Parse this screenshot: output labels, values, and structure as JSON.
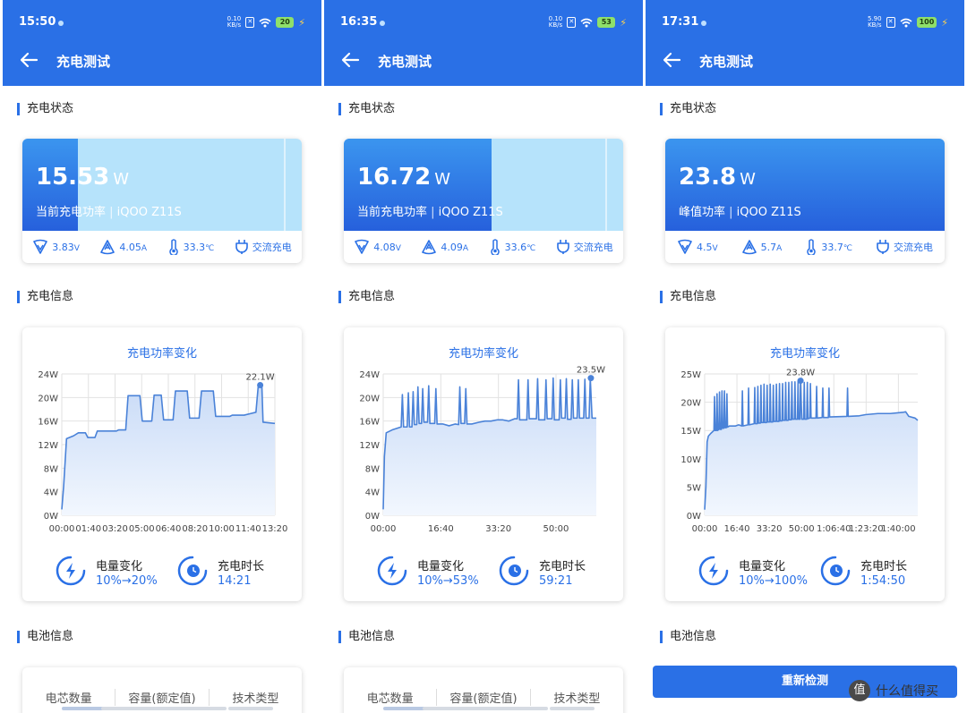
{
  "app_title": "充电测试",
  "sections": {
    "status": "充电状态",
    "info": "充电信息",
    "battery": "电池信息"
  },
  "chart_title": "充电功率变化",
  "labels": {
    "battery_change": "电量变化",
    "duration": "充电时长"
  },
  "battery_columns": [
    "电芯数量",
    "容量(额定值)",
    "技术类型"
  ],
  "recheck_button": "重新检测",
  "watermark": "什么值得买",
  "watermark_logo": "值",
  "colors": {
    "accent": "#2a70e6",
    "hero_light": "#b6e3fb",
    "status_bar": "#2a70e6"
  },
  "panels": [
    {
      "status_time": "15:50",
      "net_speed": "0.10",
      "net_unit": "KB/s",
      "battery_level": "20",
      "power_value": "15.53",
      "power_unit": "W",
      "power_label": "当前充电功率",
      "device": "iQOO Z11S",
      "hero_fill": 0.2,
      "voltage": "3.83",
      "voltage_unit": "V",
      "current": "4.05",
      "current_unit": "A",
      "temperature": "33.3",
      "temperature_unit": "℃",
      "charge_type": "交流充电",
      "battery_change": "10%→20%",
      "duration": "14:21",
      "chart_data": {
        "type": "line",
        "title": "充电功率变化",
        "y_ticks": [
          "0W",
          "4W",
          "8W",
          "12W",
          "16W",
          "20W",
          "24W"
        ],
        "ylim": [
          0,
          24
        ],
        "x_ticks": [
          "00:00",
          "01:40",
          "03:20",
          "05:00",
          "06:40",
          "08:20",
          "10:00",
          "11:40",
          "13:20"
        ],
        "xlim": [
          0,
          900
        ],
        "peak_label": "22.1W",
        "peak": [
          838,
          22.1
        ],
        "points": [
          [
            0,
            1
          ],
          [
            8,
            5
          ],
          [
            20,
            13
          ],
          [
            50,
            13.5
          ],
          [
            70,
            14
          ],
          [
            100,
            14
          ],
          [
            110,
            13.2
          ],
          [
            140,
            13.2
          ],
          [
            150,
            14.3
          ],
          [
            230,
            14.3
          ],
          [
            240,
            14.5
          ],
          [
            270,
            14.5
          ],
          [
            280,
            20.3
          ],
          [
            330,
            20.3
          ],
          [
            340,
            16
          ],
          [
            380,
            16
          ],
          [
            390,
            20.4
          ],
          [
            420,
            20.4
          ],
          [
            430,
            16.2
          ],
          [
            470,
            16.2
          ],
          [
            480,
            21.1
          ],
          [
            530,
            21.1
          ],
          [
            540,
            16.5
          ],
          [
            580,
            16.5
          ],
          [
            590,
            21.1
          ],
          [
            640,
            21.1
          ],
          [
            650,
            16.8
          ],
          [
            710,
            16.8
          ],
          [
            720,
            17
          ],
          [
            770,
            17
          ],
          [
            800,
            17.3
          ],
          [
            820,
            17.5
          ],
          [
            830,
            22.1
          ],
          [
            845,
            22.1
          ],
          [
            850,
            15.8
          ],
          [
            900,
            15.6
          ]
        ]
      }
    },
    {
      "status_time": "16:35",
      "net_speed": "0.10",
      "net_unit": "KB/s",
      "battery_level": "53",
      "power_value": "16.72",
      "power_unit": "W",
      "power_label": "当前充电功率",
      "device": "iQOO Z11S",
      "hero_fill": 0.53,
      "voltage": "4.08",
      "voltage_unit": "V",
      "current": "4.09",
      "current_unit": "A",
      "temperature": "33.6",
      "temperature_unit": "℃",
      "charge_type": "交流充电",
      "battery_change": "10%→53%",
      "duration": "59:21",
      "chart_data": {
        "type": "line",
        "title": "充电功率变化",
        "y_ticks": [
          "0W",
          "4W",
          "8W",
          "12W",
          "16W",
          "20W",
          "24W"
        ],
        "ylim": [
          0,
          24
        ],
        "x_ticks": [
          "00:00",
          "16:40",
          "33:20",
          "50:00"
        ],
        "xlim": [
          0,
          3561
        ],
        "peak_label": "23.5W",
        "peak": [
          3470,
          23.3
        ],
        "points": [
          [
            0,
            1
          ],
          [
            20,
            10
          ],
          [
            50,
            14
          ],
          [
            150,
            14.5
          ],
          [
            300,
            15
          ],
          [
            320,
            20.5
          ],
          [
            340,
            15
          ],
          [
            400,
            15
          ],
          [
            420,
            20.8
          ],
          [
            440,
            15
          ],
          [
            480,
            15
          ],
          [
            500,
            21
          ],
          [
            520,
            15.4
          ],
          [
            560,
            15.4
          ],
          [
            580,
            21.8
          ],
          [
            600,
            15.6
          ],
          [
            640,
            15.6
          ],
          [
            660,
            21.5
          ],
          [
            680,
            15.8
          ],
          [
            740,
            15.8
          ],
          [
            760,
            22
          ],
          [
            780,
            15.6
          ],
          [
            860,
            15.6
          ],
          [
            880,
            21.5
          ],
          [
            900,
            15.5
          ],
          [
            1000,
            15.5
          ],
          [
            1100,
            15.2
          ],
          [
            1200,
            15.5
          ],
          [
            1260,
            15.4
          ],
          [
            1280,
            21.8
          ],
          [
            1300,
            15.6
          ],
          [
            1360,
            15.6
          ],
          [
            1380,
            21.5
          ],
          [
            1400,
            15.5
          ],
          [
            1480,
            15.5
          ],
          [
            1600,
            15.8
          ],
          [
            1700,
            16
          ],
          [
            1800,
            16
          ],
          [
            1900,
            16.2
          ],
          [
            2000,
            16.2
          ],
          [
            2100,
            16
          ],
          [
            2200,
            16.4
          ],
          [
            2240,
            16.4
          ],
          [
            2260,
            23
          ],
          [
            2280,
            16.2
          ],
          [
            2400,
            16.2
          ],
          [
            2420,
            23
          ],
          [
            2440,
            16.4
          ],
          [
            2560,
            16.4
          ],
          [
            2580,
            23.2
          ],
          [
            2600,
            16.2
          ],
          [
            2700,
            16.2
          ],
          [
            2720,
            23
          ],
          [
            2740,
            16.4
          ],
          [
            2820,
            16.4
          ],
          [
            2840,
            23.3
          ],
          [
            2860,
            16.2
          ],
          [
            2940,
            16.2
          ],
          [
            2960,
            23
          ],
          [
            2980,
            16.5
          ],
          [
            3040,
            16.5
          ],
          [
            3060,
            23.2
          ],
          [
            3080,
            16.3
          ],
          [
            3140,
            16.3
          ],
          [
            3160,
            23
          ],
          [
            3180,
            16.5
          ],
          [
            3240,
            16.5
          ],
          [
            3260,
            23
          ],
          [
            3280,
            16.5
          ],
          [
            3350,
            16.5
          ],
          [
            3370,
            23.1
          ],
          [
            3390,
            16.5
          ],
          [
            3440,
            16.5
          ],
          [
            3460,
            23.3
          ],
          [
            3490,
            16.5
          ],
          [
            3561,
            16.5
          ]
        ]
      }
    },
    {
      "status_time": "17:31",
      "net_speed": "5.90",
      "net_unit": "KB/s",
      "battery_level": "100",
      "power_value": "23.8",
      "power_unit": "W",
      "power_label": "峰值功率",
      "device": "iQOO Z11S",
      "hero_fill": 1.0,
      "voltage": "4.5",
      "voltage_unit": "V",
      "current": "5.7",
      "current_unit": "A",
      "temperature": "33.7",
      "temperature_unit": "℃",
      "charge_type": "交流充电",
      "battery_change": "10%→100%",
      "duration": "1:54:50",
      "chart_data": {
        "type": "line",
        "title": "充电功率变化",
        "y_ticks": [
          "0W",
          "5W",
          "10W",
          "15W",
          "20W",
          "25W"
        ],
        "ylim": [
          0,
          25
        ],
        "x_ticks": [
          "00:00",
          "16:40",
          "33:20",
          "50:00",
          "1:06:40",
          "1:23:20",
          "1:40:00"
        ],
        "xlim": [
          0,
          6890
        ],
        "peak_label": "23.8W",
        "peak": [
          3100,
          23.8
        ],
        "points": [
          [
            0,
            1
          ],
          [
            40,
            5
          ],
          [
            80,
            13
          ],
          [
            120,
            14
          ],
          [
            200,
            14.5
          ],
          [
            300,
            15
          ],
          [
            320,
            21
          ],
          [
            340,
            15
          ],
          [
            380,
            15
          ],
          [
            400,
            21.5
          ],
          [
            420,
            15
          ],
          [
            460,
            15.2
          ],
          [
            480,
            21.8
          ],
          [
            500,
            15.2
          ],
          [
            540,
            15.2
          ],
          [
            560,
            22
          ],
          [
            580,
            15.4
          ],
          [
            620,
            15.4
          ],
          [
            640,
            22
          ],
          [
            660,
            15.5
          ],
          [
            700,
            15.5
          ],
          [
            720,
            21.5
          ],
          [
            740,
            15.6
          ],
          [
            800,
            15.8
          ],
          [
            900,
            15.8
          ],
          [
            1000,
            15.8
          ],
          [
            1100,
            16
          ],
          [
            1200,
            15.8
          ],
          [
            1220,
            22
          ],
          [
            1240,
            15.8
          ],
          [
            1400,
            16
          ],
          [
            1420,
            22.5
          ],
          [
            1440,
            16
          ],
          [
            1600,
            16.2
          ],
          [
            1620,
            22.6
          ],
          [
            1640,
            16.2
          ],
          [
            1700,
            16.2
          ],
          [
            1720,
            22.8
          ],
          [
            1740,
            16.3
          ],
          [
            1800,
            16.3
          ],
          [
            1820,
            23
          ],
          [
            1840,
            16.4
          ],
          [
            1900,
            16.4
          ],
          [
            1920,
            23.2
          ],
          [
            1940,
            16.4
          ],
          [
            2000,
            16.4
          ],
          [
            2020,
            23
          ],
          [
            2040,
            16.5
          ],
          [
            2100,
            16.5
          ],
          [
            2120,
            23.2
          ],
          [
            2140,
            16.5
          ],
          [
            2200,
            16.5
          ],
          [
            2220,
            23
          ],
          [
            2240,
            16.6
          ],
          [
            2300,
            16.6
          ],
          [
            2320,
            23.2
          ],
          [
            2340,
            16.6
          ],
          [
            2400,
            16.6
          ],
          [
            2420,
            23.3
          ],
          [
            2440,
            16.7
          ],
          [
            2500,
            16.7
          ],
          [
            2520,
            23.3
          ],
          [
            2540,
            16.8
          ],
          [
            2600,
            16.8
          ],
          [
            2620,
            23.5
          ],
          [
            2640,
            16.8
          ],
          [
            2700,
            16.8
          ],
          [
            2720,
            23.5
          ],
          [
            2740,
            16.9
          ],
          [
            2800,
            16.9
          ],
          [
            2820,
            23.6
          ],
          [
            2840,
            17
          ],
          [
            2900,
            17
          ],
          [
            2920,
            23.6
          ],
          [
            2940,
            17
          ],
          [
            3000,
            17
          ],
          [
            3020,
            23.7
          ],
          [
            3040,
            17
          ],
          [
            3080,
            17
          ],
          [
            3100,
            23.8
          ],
          [
            3140,
            17
          ],
          [
            3200,
            17
          ],
          [
            3220,
            23.5
          ],
          [
            3240,
            17
          ],
          [
            3300,
            17
          ],
          [
            3320,
            23.5
          ],
          [
            3340,
            17.1
          ],
          [
            3400,
            17.2
          ],
          [
            3420,
            23.3
          ],
          [
            3440,
            17.2
          ],
          [
            3600,
            17.2
          ],
          [
            3620,
            22.8
          ],
          [
            3640,
            17.2
          ],
          [
            3800,
            17.3
          ],
          [
            3820,
            22.5
          ],
          [
            3840,
            17.3
          ],
          [
            4000,
            17.3
          ],
          [
            4020,
            22.5
          ],
          [
            4040,
            17.4
          ],
          [
            4600,
            17.5
          ],
          [
            4620,
            22.5
          ],
          [
            4640,
            17.5
          ],
          [
            5000,
            17.6
          ],
          [
            5200,
            17.8
          ],
          [
            5600,
            18
          ],
          [
            6000,
            18
          ],
          [
            6400,
            18.2
          ],
          [
            6500,
            18.3
          ],
          [
            6600,
            17.5
          ],
          [
            6800,
            17.2
          ],
          [
            6890,
            16.8
          ]
        ]
      }
    }
  ]
}
